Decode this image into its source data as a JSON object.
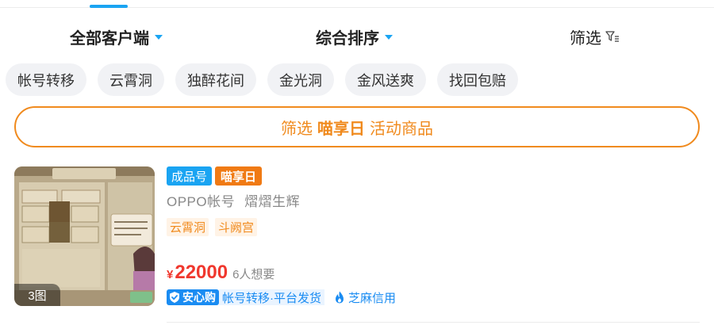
{
  "sort_bar": {
    "client": "全部客户端",
    "order": "综合排序",
    "filter": "筛选"
  },
  "chips": [
    "帐号转移",
    "云霄洞",
    "独醉花间",
    "金光洞",
    "金风送爽",
    "找回包赔"
  ],
  "promo": {
    "prefix": "筛选",
    "highlight": "喵享日",
    "suffix": "活动商品"
  },
  "listing": {
    "tags": [
      "成品号",
      "喵享日"
    ],
    "platform": "OPPO帐号",
    "name": "熠熠生辉",
    "subtags": [
      "云霄洞",
      "斗阙宫"
    ],
    "currency": "¥",
    "price": "22000",
    "wants": "6人想要",
    "photo_count": "3图",
    "safe_badge": "安心购",
    "safe_text": "帐号转移·平台发货",
    "credit": "芝麻信用"
  },
  "colors": {
    "accent_blue": "#1aa4f2",
    "accent_orange": "#f08a1d",
    "price_red": "#f0382e"
  },
  "icons": {
    "filter": "filter-funnel-icon",
    "caret": "caret-down-icon",
    "shield": "shield-check-icon",
    "flame": "zhima-flame-icon"
  }
}
